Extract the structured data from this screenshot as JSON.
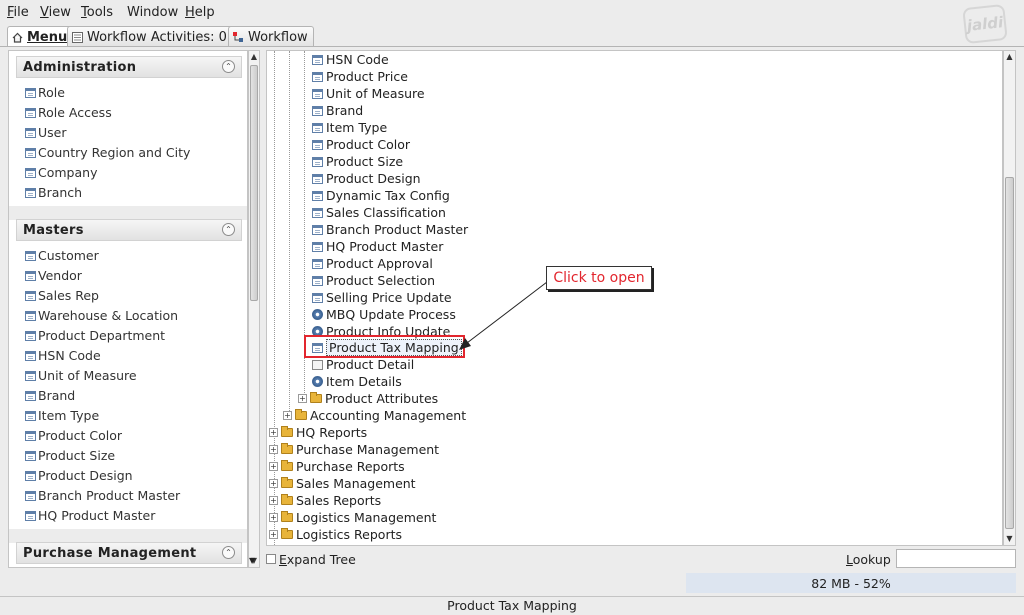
{
  "menubar": {
    "items": [
      {
        "label": "File",
        "mnemonic": "F",
        "rest": "ile"
      },
      {
        "label": "View",
        "mnemonic": "V",
        "rest": "iew"
      },
      {
        "label": "Tools",
        "mnemonic": "T",
        "rest": "ools"
      },
      {
        "label": "Window",
        "mnemonic": "",
        "rest": "Window"
      },
      {
        "label": "Help",
        "mnemonic": "H",
        "rest": "elp"
      }
    ],
    "logo_text": "jaldi"
  },
  "tabs": [
    {
      "label": "Menu",
      "icon": "home-icon",
      "active": true
    },
    {
      "label": "Workflow Activities: 0",
      "icon": "workflow-activities-icon",
      "active": false
    },
    {
      "label": "Workflow",
      "icon": "workflow-icon",
      "active": false
    }
  ],
  "left_panel": {
    "sections": [
      {
        "title": "Administration",
        "items": [
          "Role",
          "Role Access",
          "User",
          "Country Region and City",
          "Company",
          "Branch"
        ]
      },
      {
        "title": "Masters",
        "items": [
          "Customer",
          "Vendor",
          "Sales Rep",
          "Warehouse & Location",
          "Product Department",
          "HSN Code",
          "Unit of Measure",
          "Brand",
          "Item Type",
          "Product Color",
          "Product Size",
          "Product Design",
          "Branch Product Master",
          "HQ Product Master"
        ]
      },
      {
        "title": "Purchase Management",
        "items": []
      }
    ],
    "collapse_glyph": "⌃"
  },
  "tree": {
    "level2_items": [
      {
        "label": "HSN Code",
        "icon": "window-icon"
      },
      {
        "label": "Product Price",
        "icon": "window-icon"
      },
      {
        "label": "Unit of Measure",
        "icon": "window-icon"
      },
      {
        "label": "Brand",
        "icon": "window-icon"
      },
      {
        "label": "Item Type",
        "icon": "window-icon"
      },
      {
        "label": "Product Color",
        "icon": "window-icon"
      },
      {
        "label": "Product Size",
        "icon": "window-icon"
      },
      {
        "label": "Product Design",
        "icon": "window-icon"
      },
      {
        "label": "Dynamic Tax Config",
        "icon": "window-icon"
      },
      {
        "label": "Sales Classification",
        "icon": "window-icon"
      },
      {
        "label": "Branch Product Master",
        "icon": "window-icon"
      },
      {
        "label": "HQ Product Master",
        "icon": "window-icon"
      },
      {
        "label": "Product Approval",
        "icon": "window-icon"
      },
      {
        "label": "Product Selection",
        "icon": "window-icon"
      },
      {
        "label": "Selling Price Update",
        "icon": "window-icon"
      },
      {
        "label": "MBQ Update Process",
        "icon": "process-icon"
      },
      {
        "label": "Product Info Update",
        "icon": "process-icon"
      },
      {
        "label": "Product Tax Mapping",
        "icon": "window-icon",
        "selected": true
      },
      {
        "label": "Product Detail",
        "icon": "form-icon"
      },
      {
        "label": "Item Details",
        "icon": "process-icon"
      },
      {
        "label": "Product Attributes",
        "icon": "folder-icon",
        "expandable": true
      }
    ],
    "level1_items": [
      {
        "label": "Accounting Management",
        "icon": "folder-icon"
      }
    ],
    "level0_items": [
      {
        "label": "HQ Reports"
      },
      {
        "label": "Purchase Management"
      },
      {
        "label": "Purchase Reports"
      },
      {
        "label": "Sales Management"
      },
      {
        "label": "Sales Reports"
      },
      {
        "label": "Logistics Management"
      },
      {
        "label": "Logistics Reports"
      }
    ],
    "expand_glyph": "+"
  },
  "callout": {
    "text": "Click to open",
    "color": "#e2262e"
  },
  "bottom": {
    "expand_tree_label": "Expand Tree",
    "expand_tree_checked": false,
    "lookup_label": "Lookup",
    "lookup_value": "",
    "memory_text": "82 MB - 52%"
  },
  "statusbar": {
    "text": "Product Tax Mapping"
  }
}
